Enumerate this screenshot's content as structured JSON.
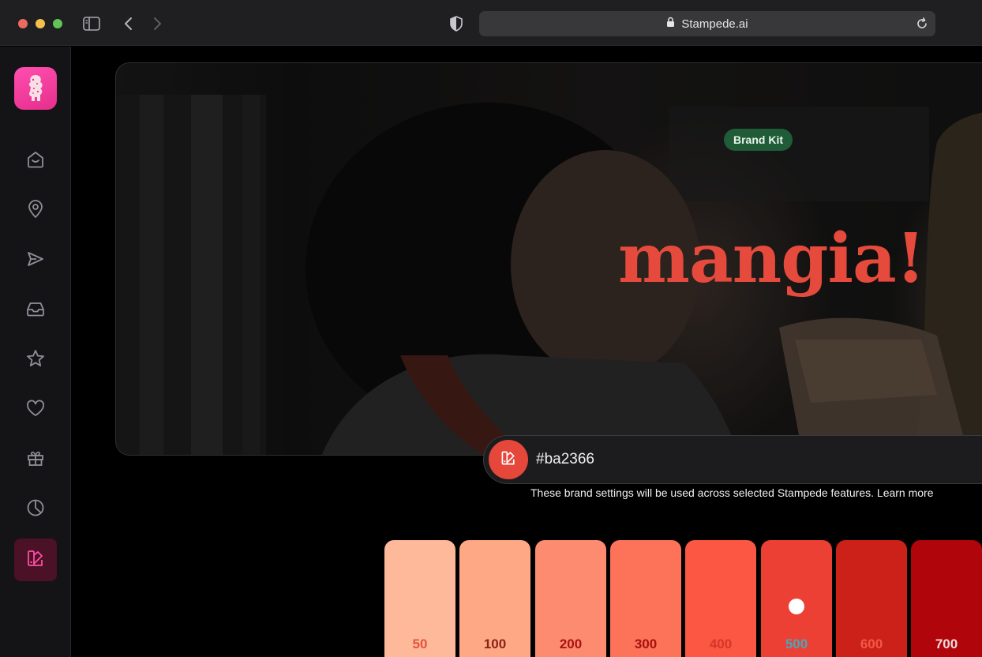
{
  "browser": {
    "url": "Stampede.ai"
  },
  "sidebar": {
    "items": [
      {
        "icon": "home-icon"
      },
      {
        "icon": "location-pin-icon"
      },
      {
        "icon": "send-icon"
      },
      {
        "icon": "inbox-icon"
      },
      {
        "icon": "star-icon"
      },
      {
        "icon": "heart-icon"
      },
      {
        "icon": "gift-icon"
      },
      {
        "icon": "pie-chart-icon"
      },
      {
        "icon": "brand-kit-icon",
        "active": true
      }
    ]
  },
  "hero": {
    "badge": "Brand Kit",
    "wordmark": "mangia!"
  },
  "color_input": {
    "value": "#ba2366"
  },
  "helper_text": "These brand settings will be used across selected Stampede features. Learn more",
  "palette": {
    "selected": "500",
    "swatches": [
      {
        "label": "50",
        "color": "#fdb99a",
        "text": "#e5533f"
      },
      {
        "label": "100",
        "color": "#fea886",
        "text": "#8a2316"
      },
      {
        "label": "200",
        "color": "#fd8b6f",
        "text": "#a8130f"
      },
      {
        "label": "300",
        "color": "#fc735a",
        "text": "#a8100e"
      },
      {
        "label": "400",
        "color": "#fb5743",
        "text": "#d7362a"
      },
      {
        "label": "500",
        "color": "#ec4034",
        "text": "#4aa7b8"
      },
      {
        "label": "600",
        "color": "#cc2118",
        "text": "#f25a46"
      },
      {
        "label": "700",
        "color": "#b0050a",
        "text": "#f3dcdc"
      }
    ]
  }
}
